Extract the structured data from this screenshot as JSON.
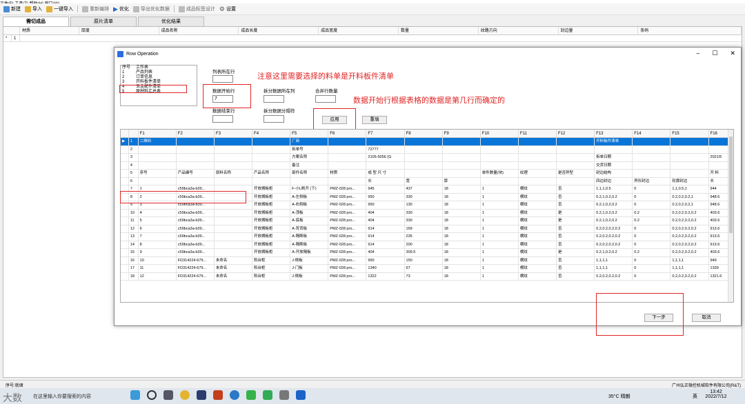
{
  "menu": "文件(F)  工具(T)  帮助(H)  窗口(W)",
  "toolbar": {
    "new": "新建",
    "import": "导入",
    "import_all": "一键导入",
    "redesign": "重新编排",
    "optimize": "优化",
    "export": "导出优化数据",
    "label_design": "成品标签设计",
    "settings": "设置"
  },
  "tabs": [
    "需切成品",
    "原片清单",
    "优化结果"
  ],
  "main_headers": [
    "材质",
    "厚度",
    "成品名称",
    "成品长度",
    "成品宽度",
    "数量",
    "纹路方向",
    "封边量",
    "条码"
  ],
  "main_row": [
    "*",
    "1"
  ],
  "dialog": {
    "title": "Row Operation",
    "sheet_list_header": [
      "序号",
      "工作表"
    ],
    "sheets": [
      [
        "1",
        "产品列表"
      ],
      [
        "2",
        "订单信息"
      ],
      [
        "3",
        "开料板件清单"
      ],
      [
        "4",
        "五金配件清单"
      ],
      [
        "5",
        "原材料汇总表"
      ]
    ],
    "labels": {
      "col_row": "列表所在行",
      "data_start": "数据开始行",
      "data_end": "数据结束行",
      "split_col": "拆分数据所在列",
      "split_sep": "拆分数据分隔符",
      "merge_rows": "合并行数量"
    },
    "data_start_value": "7",
    "buttons": {
      "apply": "应用",
      "reset": "重填",
      "next": "下一步",
      "cancel": "取消"
    },
    "annotations": {
      "a1": "注意这里需要选择的料单是开料板件清单",
      "a2": "数据开始行根据表格的数据是第几行而确定的"
    },
    "grid_headers": [
      "",
      "",
      "F1",
      "F2",
      "F3",
      "F4",
      "F5",
      "F6",
      "F7",
      "F8",
      "F9",
      "F10",
      "F11",
      "F12",
      "F13",
      "F14",
      "F15",
      "F16"
    ],
    "grid_rows": [
      [
        "▶",
        "1",
        "二维码",
        "",
        "",
        "",
        "厂商",
        "",
        "",
        "",
        "",
        "",
        "",
        "",
        "开料板件清单",
        "",
        "",
        ""
      ],
      [
        "",
        "2",
        "",
        "",
        "",
        "",
        "拆单号",
        "",
        "72777",
        "",
        "",
        "",
        "",
        "",
        "",
        "",
        "",
        ""
      ],
      [
        "",
        "3",
        "",
        "",
        "",
        "",
        "方案名称",
        "",
        "2105-5056 (G",
        "",
        "",
        "",
        "",
        "",
        "拆单日期",
        "",
        "",
        "2021/5"
      ],
      [
        "",
        "4",
        "",
        "",
        "",
        "",
        "备注",
        "",
        "",
        "",
        "",
        "",
        "",
        "",
        "交货日期",
        "",
        "",
        ""
      ],
      [
        "",
        "5",
        "序号",
        "产品编号",
        "原料名称",
        "产品名称",
        "部件名称",
        "材质",
        "成 型 尺 寸",
        "",
        "",
        "单件数量(块)",
        "纹理",
        "是否异型",
        "封边结构",
        "",
        "",
        "开 料"
      ],
      [
        "",
        "6",
        "",
        "",
        "",
        "",
        "",
        "",
        "长",
        "宽",
        "厚",
        "",
        "",
        "",
        "四边封边",
        "异形封边",
        "轮廓封边",
        "长"
      ],
      [
        "",
        "7",
        "1",
        "c59bca3a-b39...",
        "",
        "开放搁板柜",
        "F-小L刷开 (下)",
        "PMZ-028 pro...",
        "945",
        "437",
        "18",
        "1",
        "横纹",
        "否",
        "1,1,1,0.5",
        "0",
        "1,1,0.5,1",
        "944"
      ],
      [
        "",
        "8",
        "2",
        "c59bca3a-b39...",
        "",
        "开放搁板柜",
        "A-左侧板",
        "PMZ-028 pro...",
        "950",
        "330",
        "18",
        "1",
        "横纹",
        "否",
        "0.2,1,0.2,0.2",
        "0",
        "0.2,0.2,0.2,1",
        "948.6"
      ],
      [
        "",
        "9",
        "3",
        "c59bca3a-b39...",
        "",
        "开放搁板柜",
        "A-右侧板",
        "PMZ-028 pro...",
        "950",
        "130",
        "18",
        "1",
        "横纹",
        "否",
        "0.2,1,0.2,0.2",
        "0",
        "0.2,0.2,0.2,1",
        "948.6"
      ],
      [
        "",
        "10",
        "4",
        "c59bca3a-b39...",
        "",
        "开放搁板柜",
        "A-顶板",
        "PMZ-028 pro...",
        "404",
        "330",
        "18",
        "1",
        "横纹",
        "是",
        "0.2,1,0.2,0.2",
        "0.2",
        "0.2,0.2,0.2,0.2",
        "403.6"
      ],
      [
        "",
        "11",
        "5",
        "c59bca3a-b39...",
        "",
        "开放搁板柜",
        "A-底板",
        "PMZ-028 pro...",
        "404",
        "330",
        "18",
        "1",
        "横纹",
        "是",
        "0.2,1,0.2,0.2",
        "0.2",
        "0.2,0.2,0.2,0.2",
        "403.6"
      ],
      [
        "",
        "12",
        "6",
        "c59bca3a-b39...",
        "",
        "开放搁板柜",
        "A-背背板",
        "PMZ-028 pro...",
        "914",
        "169",
        "18",
        "1",
        "横纹",
        "否",
        "0.2,0.2,0.2,0.2",
        "0",
        "0.2,0.2,0.2,0.2",
        "913.6"
      ],
      [
        "",
        "13",
        "7",
        "c59bca3a-b39...",
        "",
        "开放搁板柜",
        "A-隔断板",
        "PMZ-028 pro...",
        "914",
        "235",
        "18",
        "1",
        "横纹",
        "否",
        "0.2,0.2,0.2,0.2",
        "0",
        "0.2,0.2,0.2,0.2",
        "913.6"
      ],
      [
        "",
        "14",
        "8",
        "c59bca3a-b39...",
        "",
        "开放搁板柜",
        "A-隔断板",
        "PMZ-028 pro...",
        "914",
        "200",
        "18",
        "1",
        "横纹",
        "否",
        "0.2,0.2,0.2,0.2",
        "0",
        "0.2,0.2,0.2,0.2",
        "913.6"
      ],
      [
        "",
        "15",
        "9",
        "c59bca3a-b39...",
        "",
        "开放搁板柜",
        "A-开放隔板",
        "PMZ-028 pro...",
        "404",
        "309.5",
        "18",
        "1",
        "横纹",
        "是",
        "0.2,1,0.2,0.2",
        "0.2",
        "0.2,0.2,0.2,0.2",
        "403.6"
      ],
      [
        "",
        "16",
        "10",
        "FD314224-679...",
        "未命名",
        "阳台柜",
        "J-侧板",
        "PMZ-028 pro...",
        "950",
        "150",
        "18",
        "1",
        "横纹",
        "否",
        "1,1,1,1",
        "0",
        "1,1,1,1",
        "949"
      ],
      [
        "",
        "17",
        "11",
        "FD314224-679...",
        "未命名",
        "阳台柜",
        "J-门板",
        "PMZ-028 pro...",
        "1340",
        "67",
        "18",
        "1",
        "横纹",
        "否",
        "1,1,1,1",
        "0",
        "1,1,1,1",
        "1339"
      ],
      [
        "",
        "18",
        "12",
        "FD314224-679...",
        "未命名",
        "阳台柜",
        "J-侧板",
        "PMZ-028 pro...",
        "1322",
        "73",
        "18",
        "1",
        "横纹",
        "否",
        "0.2,0.2,0.2,0.2",
        "0",
        "0.2,0.2,0.2,0.2",
        "1321.6"
      ]
    ]
  },
  "status_left": "序号:就绪",
  "status_right": "广州弘正微控机械软件有限公司(R&T)",
  "taskbar": {
    "search": "在这里输入你要搜索的内容",
    "weather": "35°C 晴朗",
    "time": "13:42",
    "date": "2022/7/12",
    "ime": "英"
  },
  "watermark": "大数暗滤"
}
